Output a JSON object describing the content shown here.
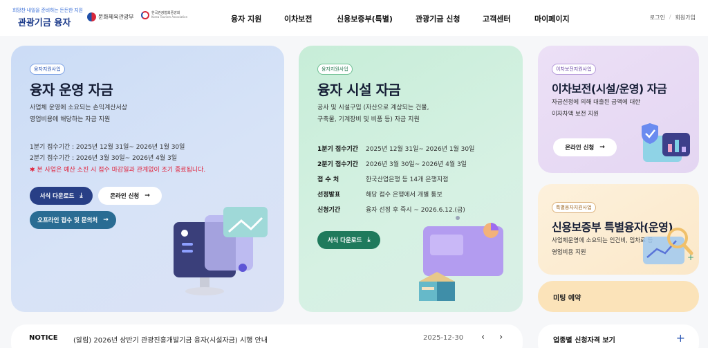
{
  "header": {
    "slogan": "희망찬 내일을 준비하는 든든한 지원",
    "brand": "관광기금 융자",
    "ministry": "문화체육관광부",
    "kto_ko": "한국관광협회중앙회",
    "kto_en": "Korea Tourism Association",
    "nav": [
      "융자 지원",
      "이차보전",
      "신용보증부(특별)",
      "관광기금 신청",
      "고객센터",
      "마이페이지"
    ],
    "login": "로그인",
    "signup": "회원가입",
    "util_sep": "/"
  },
  "card_operation": {
    "tag": "융자지원사업",
    "title": "융자 운영 자금",
    "desc": [
      "사업체 운영에 소요되는 손익계산서상",
      "영업비용에 해당하는 자금 지원"
    ],
    "periods": [
      "1분기 접수기간 : 2025년 12월 31일~ 2026년 1월 30일",
      "2분기 접수기간 : 2026년  3월 30일~ 2026년 4월 3일"
    ],
    "warning": "✱ 본 사업은 예산 소진 시 접수 마감일과 관계없이 조기 종료됩니다.",
    "btn_download": "서식 다운로드",
    "btn_online": "온라인 신청",
    "btn_offline": "오프라인 접수 및 문의처"
  },
  "card_facility": {
    "tag": "융자지원사업",
    "title": "융자 시설 자금",
    "desc": [
      "공사 및 시설구입 (자산으로 계상되는 건물,",
      "구축물, 기계장비 및 비품 등) 자금 지원"
    ],
    "info": [
      {
        "k": "1분기 접수기간",
        "v": "2025년 12월 31일~ 2026년 1월 30일"
      },
      {
        "k": "2분기 접수기간",
        "v": "2026년 3월 30일~ 2026년 4월 3일"
      },
      {
        "k": "접 수 처",
        "v": "한국산업은행 등 14개 은행지점"
      },
      {
        "k": "선정발표",
        "v": "해당 접수 은행에서 개별 통보"
      },
      {
        "k": "신청기간",
        "v": "융자 선정 후 즉시 ~ 2026.6.12.(금)"
      }
    ],
    "btn_download": "서식 다운로드"
  },
  "card_interest": {
    "tag": "이차보전지원사업",
    "title": "이차보전(시설/운영) 자금",
    "desc": [
      "자금선정에 의해 대출된 금액에 대한",
      "이자차액 보전 지원"
    ],
    "btn_online": "온라인 신청"
  },
  "card_credit": {
    "tag": "특별융자지원사업",
    "title": "신용보증부 특별융자(운영)",
    "desc": [
      "사업체운영에 소요되는 인건비, 임차료 등",
      "영업비용 지원"
    ]
  },
  "meeting": "미팅 예약",
  "notice": {
    "label": "NOTICE",
    "text": "(알림) 2026년 상반기 관광진흥개발기금 융자(시설자금) 시행 안내",
    "date": "2025-12-30",
    "prev": "‹",
    "next": "›"
  },
  "qualification": {
    "label": "업종별 신청자격 보기",
    "plus": "+"
  },
  "icons": {
    "download": "⤓",
    "arrow": "→"
  },
  "colors": {
    "navy": "#283f86",
    "green": "#1f7a5c",
    "teal": "#2a6c93",
    "warning": "#e0213a"
  }
}
